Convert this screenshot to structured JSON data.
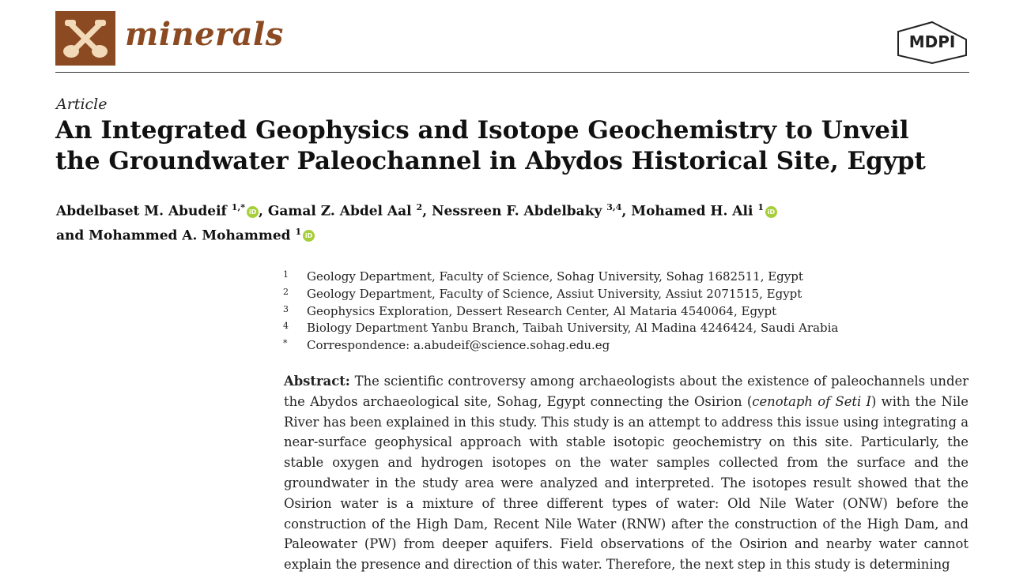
{
  "journal": {
    "name": "minerals",
    "publisher": "MDPI",
    "brand_color": "#8b4a21"
  },
  "article_type": "Article",
  "title_lines": [
    "An Integrated Geophysics and Isotope Geochemistry to Unveil",
    "the Groundwater Paleochannel in Abydos Historical Site, Egypt"
  ],
  "authors": [
    {
      "name": "Abdelbaset M. Abudeif",
      "sup": "1,*",
      "orcid": true,
      "sep": ", "
    },
    {
      "name": "Gamal Z. Abdel Aal",
      "sup": "2",
      "orcid": false,
      "sep": ", "
    },
    {
      "name": "Nessreen F. Abdelbaky",
      "sup": "3,4",
      "orcid": false,
      "sep": ", "
    },
    {
      "name": "Mohamed H. Ali",
      "sup": "1",
      "orcid": true,
      "sep": ""
    },
    {
      "name": "and Mohammed A. Mohammed",
      "sup": "1",
      "orcid": true,
      "sep": ""
    }
  ],
  "orcid_label": "iD",
  "affiliations": [
    {
      "num": "1",
      "text": "Geology Department, Faculty of Science, Sohag University, Sohag 1682511, Egypt"
    },
    {
      "num": "2",
      "text": "Geology Department, Faculty of Science, Assiut University, Assiut 2071515, Egypt"
    },
    {
      "num": "3",
      "text": "Geophysics Exploration, Dessert Research Center, Al Mataria 4540064, Egypt"
    },
    {
      "num": "4",
      "text": "Biology Department Yanbu Branch, Taibah University, Al Madina 4246424, Saudi Arabia"
    },
    {
      "num": "*",
      "text": "Correspondence: a.abudeif@science.sohag.edu.eg"
    }
  ],
  "abstract": {
    "label": "Abstract:",
    "part1": "The scientific controversy among archaeologists about the existence of paleochannels under the Abydos archaeological site, Sohag, Egypt connecting the Osirion (",
    "italic": "cenotaph of Seti I",
    "part2": ") with the Nile River has been explained in this study. This study is an attempt to address this issue using integrating a near-surface geophysical approach with stable isotopic geochemistry on this site. Particularly, the stable oxygen and hydrogen isotopes on the water samples collected from the surface and the groundwater in the study area were analyzed and interpreted. The isotopes result showed that the Osirion water is a mixture of three different types of water: Old Nile Water (ONW) before the construction of the High Dam, Recent Nile Water (RNW) after the construction of the High Dam, and Paleowater (PW) from deeper aquifers. Field observations of the Osirion and nearby water cannot explain the presence and direction of this water. Therefore, the next step in this study is determining"
  }
}
